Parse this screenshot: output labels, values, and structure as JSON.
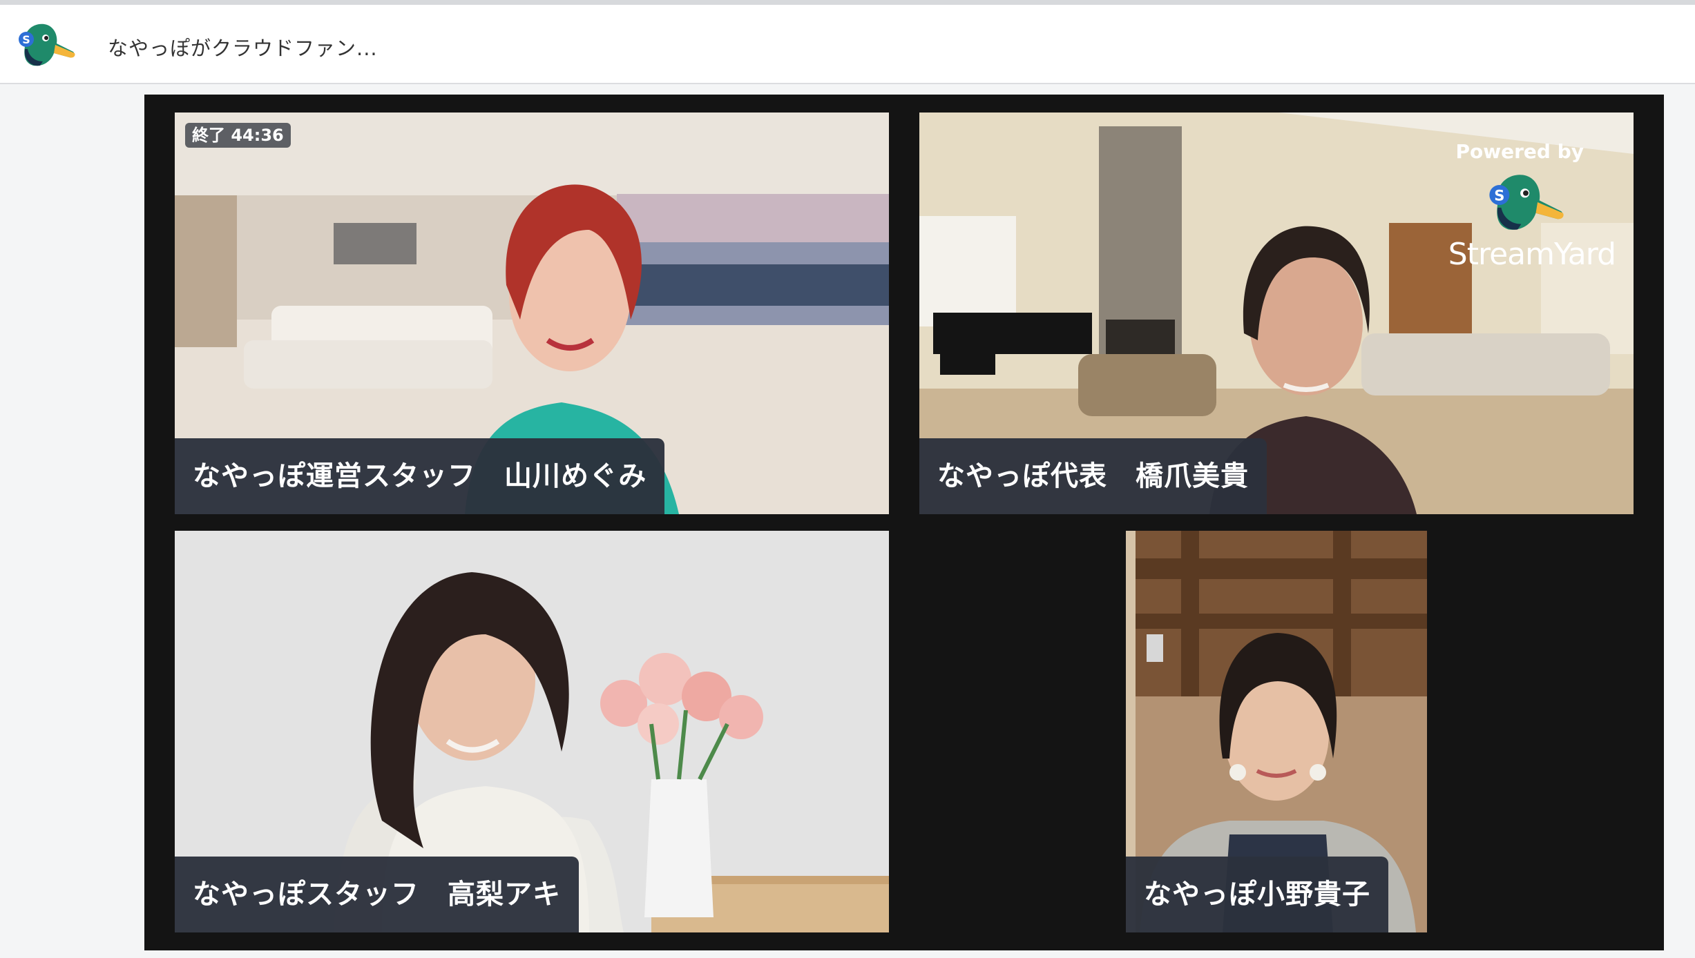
{
  "header": {
    "title": "なやっぽがクラウドファン..."
  },
  "stage": {
    "timer": "終了 44:36",
    "branding": {
      "powered_by": "Powered by",
      "brand": "StreamYard"
    },
    "participants": [
      {
        "name": "なやっぽ運営スタッフ　山川めぐみ"
      },
      {
        "name": "なやっぽ代表　橋爪美貴"
      },
      {
        "name": "なやっぽスタッフ　高梨アキ"
      },
      {
        "name": "なやっぽ小野貴子"
      }
    ]
  },
  "colors": {
    "stage_bg": "#141414",
    "nameplate_bg": "#2c313c",
    "header_bg": "#ffffff"
  }
}
